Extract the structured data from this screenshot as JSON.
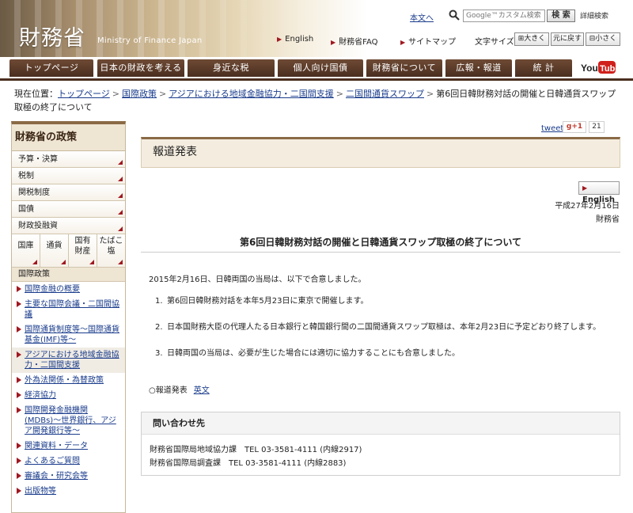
{
  "header": {
    "logo_jp": "財務省",
    "logo_en": "Ministry of Finance Japan",
    "skip_link": "本文へ",
    "search_placeholder": "Google™カスタム検索",
    "search_button": "検 索",
    "detail_search": "詳細検索",
    "links": [
      "English",
      "財務省FAQ",
      "サイトマップ"
    ],
    "font_size_label": "文字サイズ",
    "font_buttons": [
      "大きく",
      "元に戻す",
      "小さく"
    ]
  },
  "nav": {
    "tabs": [
      "トップページ",
      "日本の財政を考える",
      "身近な税",
      "個人向け国債",
      "財務省について",
      "広報・報道",
      "統 計"
    ],
    "youtube": "YouTube"
  },
  "breadcrumb": {
    "label": "現在位置：",
    "items": [
      "トップページ",
      "国際政策",
      "アジアにおける地域金融協力・二国間支援",
      "二国間通貨スワップ"
    ],
    "current": "第6回日韓財務対話の開催と日韓通貨スワップ取極の終了について"
  },
  "sidebar": {
    "title": "財務省の政策",
    "items": [
      "予算・決算",
      "税制",
      "関税制度",
      "国債",
      "財政投融資"
    ],
    "row": [
      "国庫",
      "通貨",
      "国有\n財産",
      "たばこ\n塩"
    ],
    "sub_title": "国際政策",
    "links": [
      "国際金融の概要",
      "主要な国際会議・二国間協議",
      "国際通貨制度等〜国際通貨基金(IMF)等〜",
      "アジアにおける地域金融協力・二国間支援",
      "外為法関係・為替政策",
      "経済協力",
      "国際開発金融機関(MDBs)〜世界銀行、アジア開発銀行等〜",
      "関連資料・データ",
      "よくあるご質問",
      "審議会・研究会等",
      "出版物等"
    ]
  },
  "share": {
    "tweet": "tweet",
    "gplus": "g+1",
    "count": "21"
  },
  "main": {
    "section_title": "報道発表",
    "english_button": "English",
    "date": "平成27年2月16日",
    "ministry": "財務省",
    "title": "第6回日韓財務対話の開催と日韓通貨スワップ取極の終了について",
    "intro": "2015年2月16日、日韓両国の当局は、以下で合意しました。",
    "items": [
      "第6回日韓財務対話を本年5月23日に東京で開催します。",
      "日本国財務大臣の代理人たる日本銀行と韓国銀行間の二国間通貨スワップ取極は、本年2月23日に予定どおり終了します。",
      "日韓両国の当局は、必要が生じた場合には適切に協力することにも合意しました。"
    ],
    "item_numbers": [
      "1.",
      "2.",
      "3."
    ],
    "press_label": "○報道発表",
    "press_link": "英文"
  },
  "contact": {
    "heading": "問い合わせ先",
    "lines": [
      "財務省国際局地域協力課　TEL 03-3581-4111 (内線2917)",
      "財務省国際局調査課　TEL 03-3581-4111 (内線2883)"
    ]
  },
  "colors": {
    "brand_brown": "#4a2e20",
    "accent_red": "#a01820",
    "link_blue": "#1a3c8c"
  }
}
